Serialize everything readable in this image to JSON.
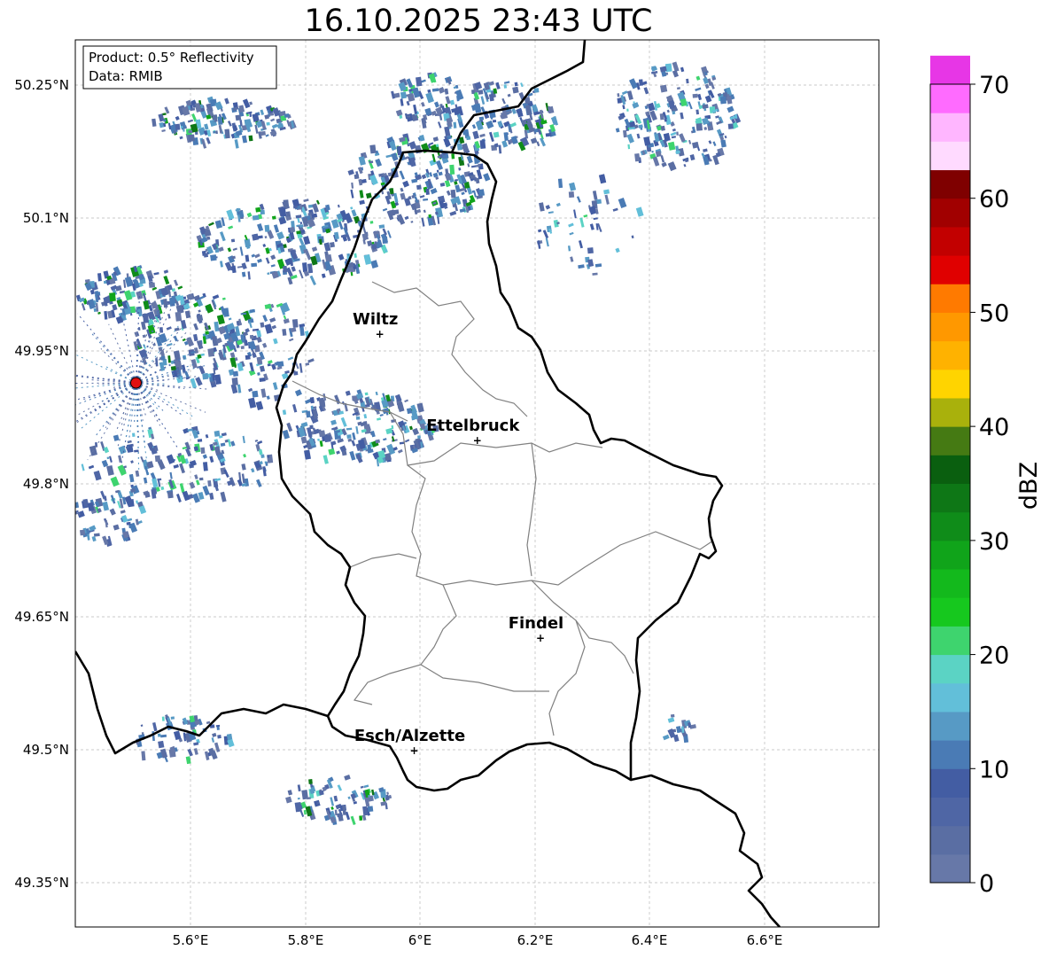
{
  "title": "16.10.2025 23:43 UTC",
  "info_box": {
    "product": "Product: 0.5° Reflectivity",
    "data": "Data: RMIB"
  },
  "latitude_ticks": [
    "50.25°N",
    "50.1°N",
    "49.95°N",
    "49.8°N",
    "49.65°N",
    "49.5°N",
    "49.35°N"
  ],
  "longitude_ticks": [
    "5.6°E",
    "5.8°E",
    "6°E",
    "6.2°E",
    "6.4°E",
    "6.6°E"
  ],
  "cities": [
    {
      "name": "Wiltz",
      "lon": 5.93,
      "lat": 49.97
    },
    {
      "name": "Ettelbruck",
      "lon": 6.1,
      "lat": 49.85
    },
    {
      "name": "Findel",
      "lon": 6.21,
      "lat": 49.627
    },
    {
      "name": "Esch/Alzette",
      "lon": 5.99,
      "lat": 49.5
    }
  ],
  "radar_site": {
    "lon": 5.505,
    "lat": 49.914
  },
  "map_extent": {
    "lon_min": 5.4,
    "lon_max": 6.8,
    "lat_min": 49.3,
    "lat_max": 50.3
  },
  "colorbar": {
    "label": "dBZ",
    "ticks": [
      "0",
      "10",
      "20",
      "30",
      "40",
      "50",
      "60",
      "70"
    ],
    "min": 0,
    "max": 70,
    "step": 2.5,
    "colors": [
      "#6778a8",
      "#5a6ea3",
      "#4f66a5",
      "#435da3",
      "#4a7bb5",
      "#579ac5",
      "#62bfd9",
      "#5bd3c4",
      "#3ed46e",
      "#16c81e",
      "#13b91c",
      "#10a41a",
      "#0f8c19",
      "#0e7716",
      "#0a5f0f",
      "#457a13",
      "#a9b10c",
      "#ffd400",
      "#ffb200",
      "#ff9800",
      "#ff7a00",
      "#e00000",
      "#c20000",
      "#a10000",
      "#7f0000",
      "#ffdaff",
      "#ffb6ff",
      "#ff6bff",
      "#e736e6"
    ]
  }
}
